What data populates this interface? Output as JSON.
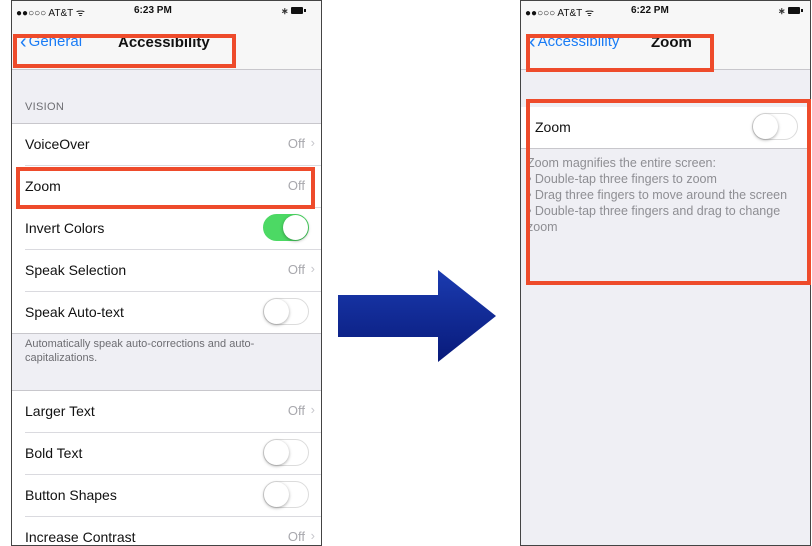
{
  "left_phone": {
    "status": {
      "carrier": "●●○○○ AT&T ᯤ",
      "time": "6:23 PM",
      "bluetooth": "∗"
    },
    "nav": {
      "back_label": "General",
      "title": "Accessibility"
    },
    "section_header": "VISION",
    "rows1": [
      {
        "label": "VoiceOver",
        "value": "Off"
      },
      {
        "label": "Zoom",
        "value": "Off"
      },
      {
        "label": "Invert Colors",
        "toggle": "on"
      },
      {
        "label": "Speak Selection",
        "value": "Off"
      },
      {
        "label": "Speak Auto-text",
        "toggle": "off"
      }
    ],
    "footer_note": "Automatically speak auto-corrections and auto-capitalizations.",
    "rows2": [
      {
        "label": "Larger Text",
        "value": "Off"
      },
      {
        "label": "Bold Text",
        "toggle": "off"
      },
      {
        "label": "Button Shapes",
        "toggle": "off"
      },
      {
        "label": "Increase Contrast",
        "value": "Off"
      }
    ]
  },
  "right_phone": {
    "status": {
      "carrier": "●●○○○ AT&T ᯤ",
      "time": "6:22 PM",
      "bluetooth": "∗"
    },
    "nav": {
      "back_label": "Accessibility",
      "title": "Zoom"
    },
    "zoom_row": {
      "label": "Zoom",
      "toggle": "off"
    },
    "description": {
      "heading": "Zoom magnifies the entire screen:",
      "bullets": [
        "• Double-tap three fingers to zoom",
        "• Drag three fingers to move around the screen",
        "• Double-tap three fingers and drag to change zoom"
      ]
    }
  },
  "colors": {
    "highlight": "#ee4b2b",
    "arrow": "#0a1f8f",
    "ios_blue": "#1a7cf5",
    "toggle_on": "#4cd964"
  },
  "icons": {
    "back": "chevron-left-icon",
    "disclosure": "chevron-right-icon",
    "arrow": "right-arrow-icon"
  }
}
